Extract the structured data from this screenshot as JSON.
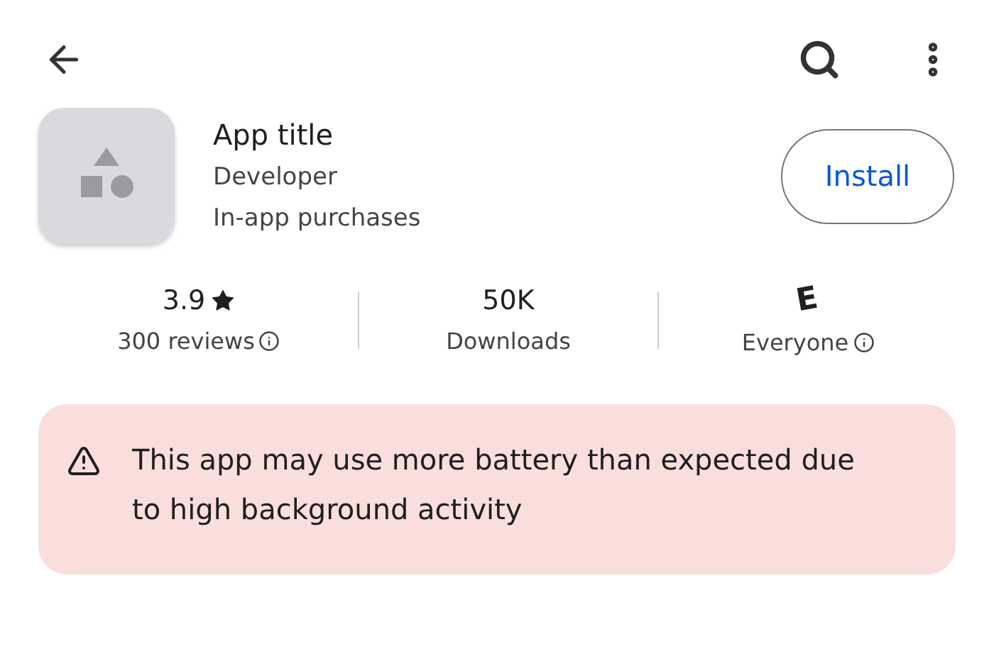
{
  "app": {
    "title": "App title",
    "developer": "Developer",
    "note": "In-app purchases"
  },
  "install_button": "Install",
  "stats": [
    {
      "kind": "rating",
      "value": "3.9",
      "label": "300 reviews",
      "info": true
    },
    {
      "kind": "plain",
      "value": "50K",
      "label": "Downloads",
      "info": false
    },
    {
      "kind": "badge",
      "value": "E",
      "label": "Everyone",
      "info": true
    }
  ],
  "warning": {
    "text": "This app may use more battery than expected due to high background activity"
  }
}
